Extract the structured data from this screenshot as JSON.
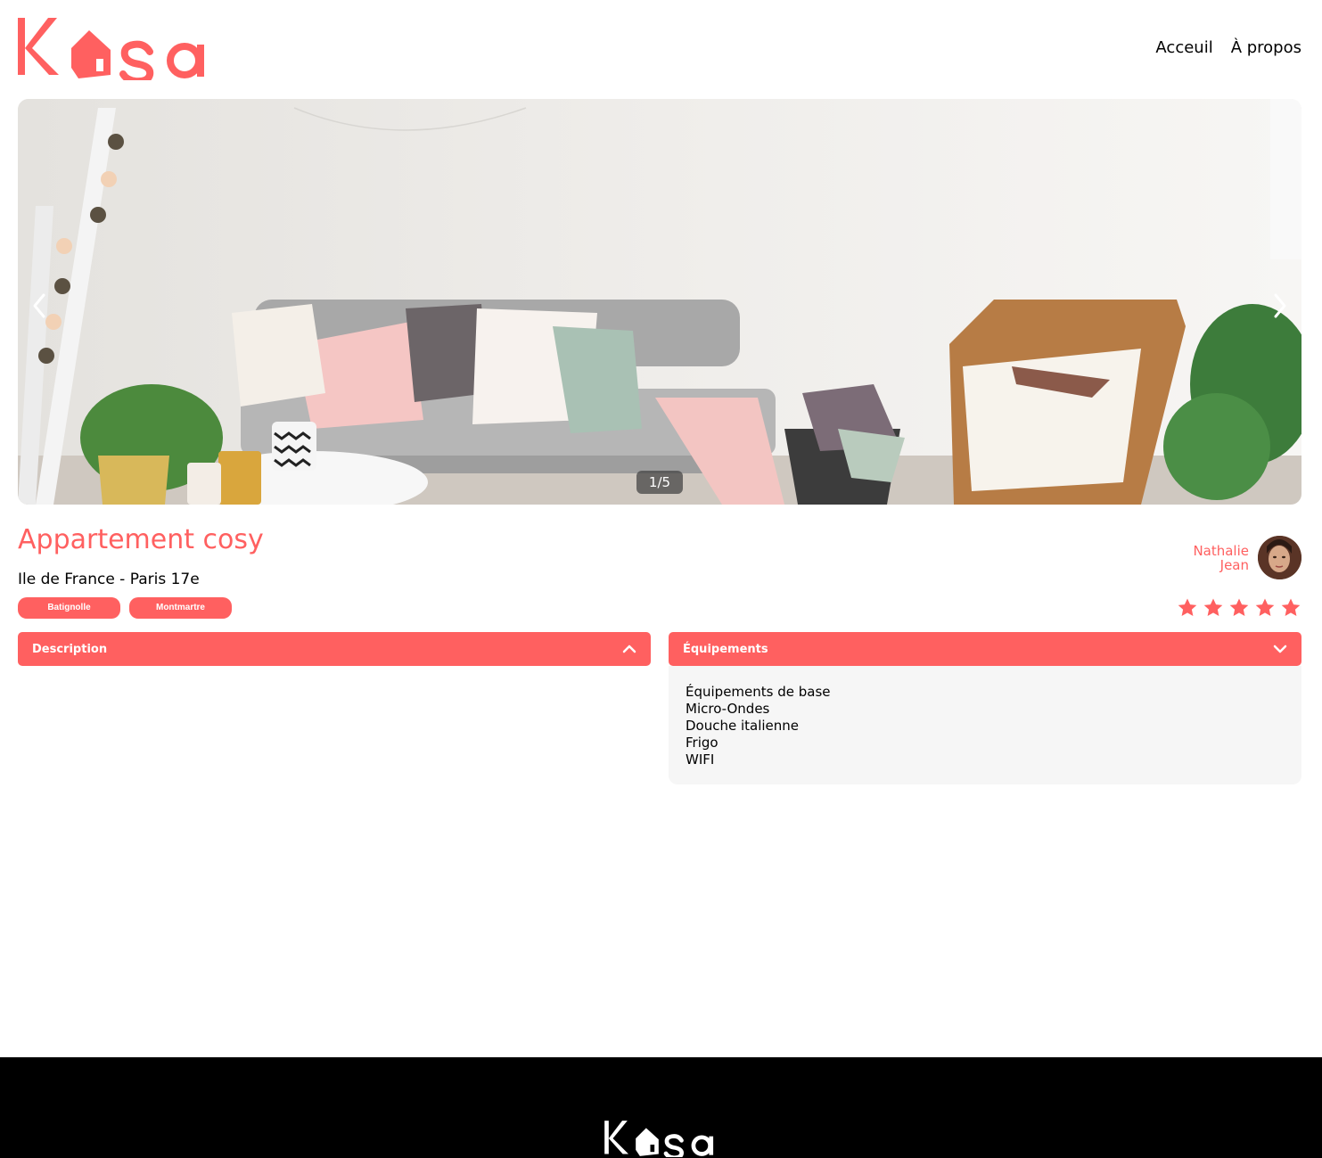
{
  "brand": {
    "logo_text": "Kasa",
    "accent_color": "#ff6060"
  },
  "nav": {
    "home_label": "Acceuil",
    "about_label": "À propos"
  },
  "carousel": {
    "counter": "1/5",
    "current_index": 1,
    "total": 5,
    "prev_icon": "chevron-left-icon",
    "next_icon": "chevron-right-icon"
  },
  "listing": {
    "title": "Appartement cosy",
    "location": "Ile de France - Paris 17e",
    "tags": [
      "Batignolle",
      "Montmartre"
    ],
    "host": {
      "first_name": "Nathalie",
      "last_name": "Jean"
    },
    "rating": 5,
    "rating_max": 5
  },
  "collapses": {
    "description": {
      "label": "Description",
      "open": false,
      "icon": "chevron-up-icon"
    },
    "equipments": {
      "label": "Équipements",
      "open": true,
      "icon": "chevron-down-icon",
      "items": [
        "Équipements de base",
        "Micro-Ondes",
        "Douche italienne",
        "Frigo",
        "WIFI"
      ]
    }
  }
}
